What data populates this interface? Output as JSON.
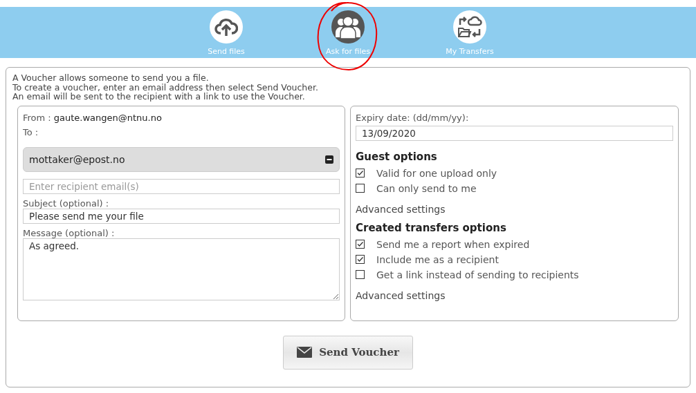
{
  "nav": [
    {
      "kind": "upload",
      "label": "Send files",
      "selected": false
    },
    {
      "kind": "people",
      "label": "Ask for files",
      "selected": true
    },
    {
      "kind": "transfers",
      "label": "My Transfers",
      "selected": false
    }
  ],
  "intro": [
    "A Voucher allows someone to send you a file.",
    "To create a voucher, enter an email address then select Send Voucher.",
    "An email will be sent to the recipient with a link to use the Voucher."
  ],
  "from_label": "From :",
  "from_value": "gaute.wangen@ntnu.no",
  "to_label": "To :",
  "recipients": [
    "mottaker@epost.no"
  ],
  "recipient_field": {
    "placeholder": "Enter recipient email(s)"
  },
  "subject": {
    "label": "Subject (optional) :",
    "value": "Please send me your file"
  },
  "message": {
    "label": "Message (optional) :",
    "value": "As agreed."
  },
  "expiry": {
    "label": "Expiry date: (dd/mm/yy):",
    "value": "13/09/2020"
  },
  "option_groups": [
    {
      "title": "Guest options",
      "options": [
        {
          "label": "Valid for one upload only",
          "checked": true
        },
        {
          "label": "Can only send to me",
          "checked": false
        }
      ],
      "advanced": "Advanced settings"
    },
    {
      "title": "Created transfers options",
      "options": [
        {
          "label": "Send me a report when expired",
          "checked": true
        },
        {
          "label": "Include me as a recipient",
          "checked": true
        },
        {
          "label": "Get a link instead of sending to recipients",
          "checked": false
        }
      ],
      "advanced": "Advanced settings"
    }
  ],
  "send_button": "Send Voucher"
}
